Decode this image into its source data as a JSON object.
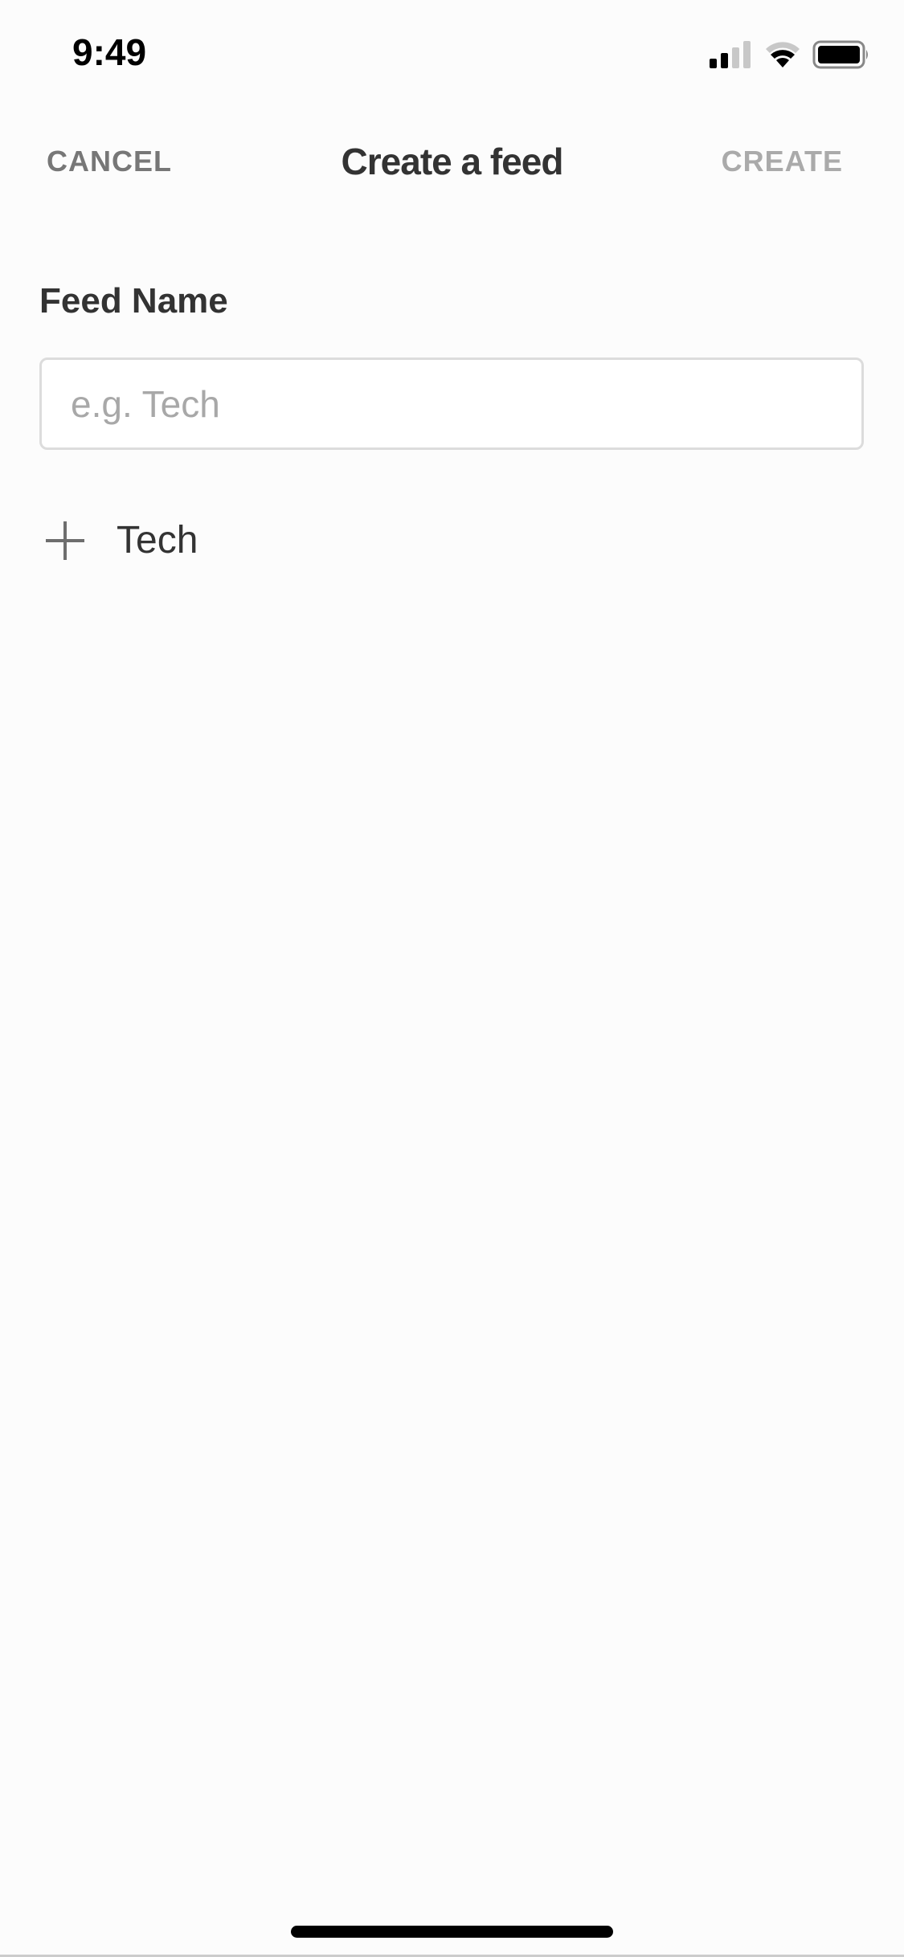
{
  "status_bar": {
    "time": "9:49",
    "icons": [
      "cellular-signal-icon",
      "wifi-icon",
      "battery-icon"
    ]
  },
  "nav": {
    "cancel_label": "CANCEL",
    "title": "Create a feed",
    "create_label": "CREATE"
  },
  "form": {
    "feed_name_label": "Feed Name",
    "feed_name_value": "",
    "feed_name_placeholder": "e.g. Tech"
  },
  "suggestions": [
    {
      "icon": "plus-icon",
      "label": "Tech"
    }
  ],
  "colors": {
    "background": "#fcfcfc",
    "title_text": "#333333",
    "cancel_text": "#777777",
    "create_text_disabled": "#aaaaaa",
    "input_border": "#dcdcdc",
    "placeholder": "#a8a8a8"
  }
}
